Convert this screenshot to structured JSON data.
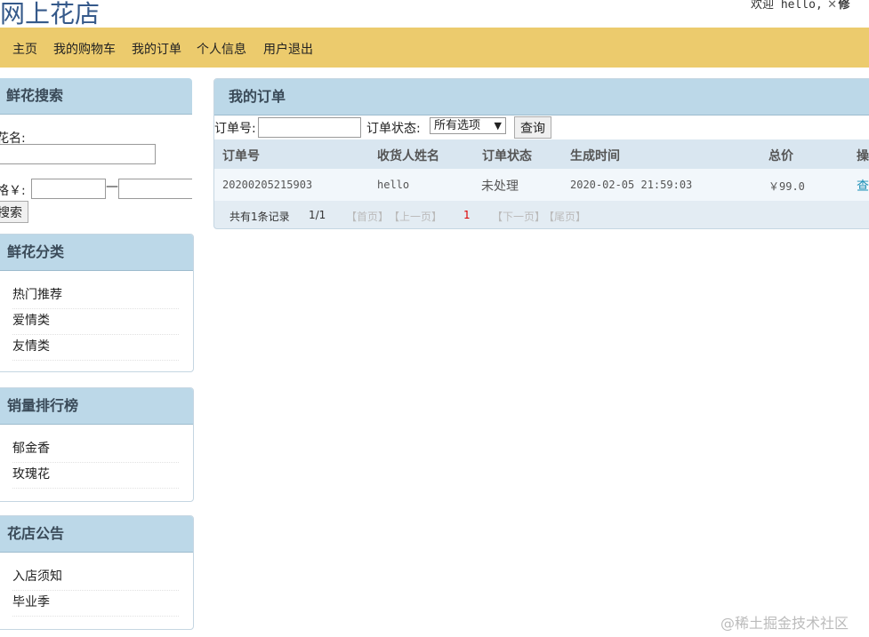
{
  "header": {
    "site_title": "网上花店",
    "welcome_text": "欢迎 hello,",
    "tool_icon": "wrench-icon",
    "cut_text": "修"
  },
  "nav": {
    "items": [
      "主页",
      "我的购物车",
      "我的订单",
      "个人信息",
      "用户退出"
    ]
  },
  "search_panel": {
    "title": "鲜花搜索",
    "name_label": "花名:",
    "name_value": "",
    "price_label": "格￥:",
    "price_min": "",
    "price_sep": "—",
    "price_max": "",
    "button_label": "搜索"
  },
  "category_panel": {
    "title": "鲜花分类",
    "items": [
      "热门推荐",
      "爱情类",
      "友情类"
    ]
  },
  "ranking_panel": {
    "title": "销量排行榜",
    "items": [
      "郁金香",
      "玫瑰花"
    ]
  },
  "notice_panel": {
    "title": "花店公告",
    "items": [
      "入店须知",
      "毕业季"
    ]
  },
  "orders": {
    "title": "我的订单",
    "filter": {
      "order_no_label": "订单号:",
      "order_no_value": "",
      "status_label": "订单状态:",
      "status_selected": "所有选项",
      "query_button": "查询"
    },
    "columns": [
      "订单号",
      "收货人姓名",
      "订单状态",
      "生成时间",
      "总价",
      "操"
    ],
    "rows": [
      {
        "order_no": "20200205215903",
        "receiver": "hello",
        "status": "未处理",
        "created": "2020-02-05 21:59:03",
        "total": "￥99.0",
        "action": "查"
      }
    ],
    "pager": {
      "total_text": "共有1条记录",
      "page_text": "1/1",
      "first": "【首页】",
      "prev": "【上一页】",
      "current": "1",
      "next": "【下一页】",
      "last": "【尾页】"
    }
  },
  "watermark": "@稀土掘金技术社区"
}
